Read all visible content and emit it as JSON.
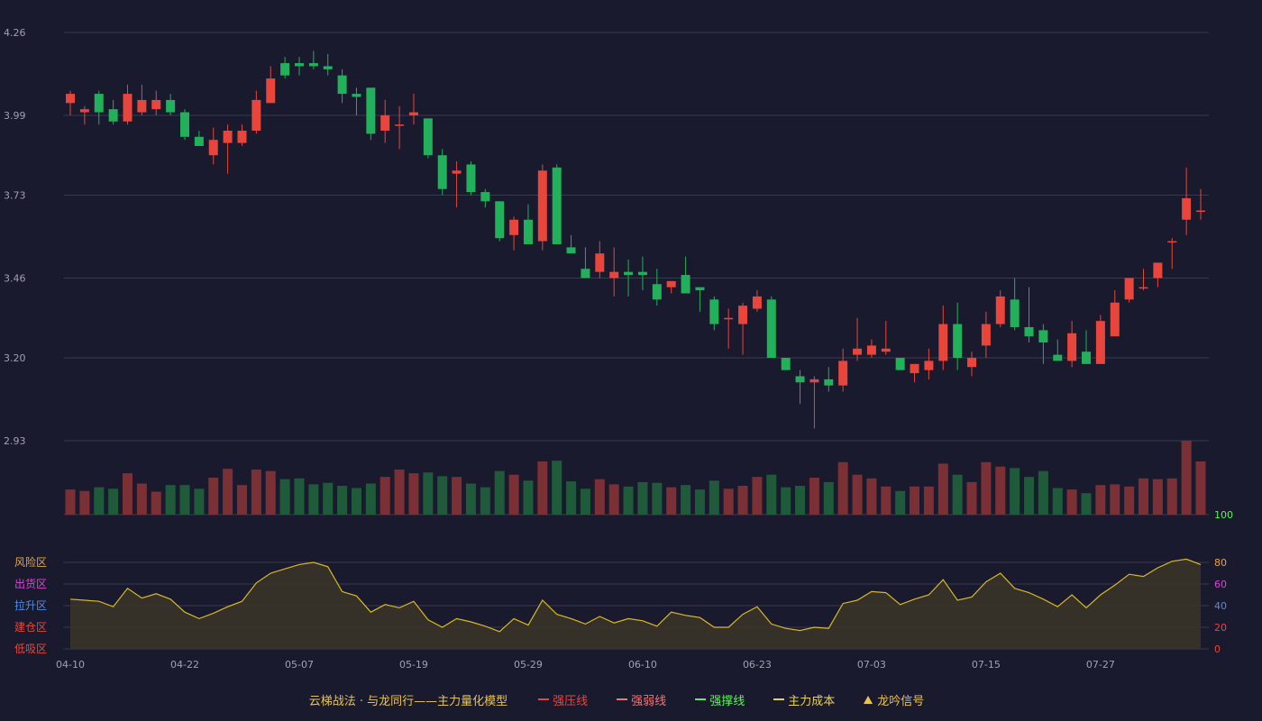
{
  "colors": {
    "background": "#1a1a2e",
    "up": "#e8453c",
    "down": "#22b05a",
    "vol_up": "#7a3035",
    "vol_down": "#1f5a3a",
    "grid": "#3a3a4e",
    "axis_text": "#a0a0b0",
    "osc_line": "#d9b823",
    "osc_fill": "#3a3428"
  },
  "chart_data": [
    {
      "type": "candlestick",
      "ylim": [
        2.93,
        4.26
      ],
      "yticks": [
        "4.26",
        "3.99",
        "3.73",
        "3.46",
        "3.20",
        "2.93"
      ],
      "x_tick_labels": [
        {
          "index": 0,
          "label": "04-10"
        },
        {
          "index": 8,
          "label": "04-22"
        },
        {
          "index": 16,
          "label": "05-07"
        },
        {
          "index": 24,
          "label": "05-19"
        },
        {
          "index": 32,
          "label": "05-29"
        },
        {
          "index": 40,
          "label": "06-10"
        },
        {
          "index": 48,
          "label": "06-23"
        },
        {
          "index": 56,
          "label": "07-03"
        },
        {
          "index": 64,
          "label": "07-15"
        },
        {
          "index": 72,
          "label": "07-27"
        }
      ],
      "candles": [
        [
          4.03,
          4.07,
          3.99,
          4.06
        ],
        [
          4.0,
          4.02,
          3.96,
          4.01
        ],
        [
          4.06,
          4.07,
          3.96,
          4.0
        ],
        [
          4.01,
          4.04,
          3.96,
          3.97
        ],
        [
          3.97,
          4.09,
          3.96,
          4.06
        ],
        [
          4.0,
          4.09,
          3.99,
          4.04
        ],
        [
          4.01,
          4.07,
          3.99,
          4.04
        ],
        [
          4.04,
          4.06,
          3.99,
          4.0
        ],
        [
          4.0,
          4.01,
          3.91,
          3.92
        ],
        [
          3.92,
          3.94,
          3.89,
          3.89
        ],
        [
          3.86,
          3.95,
          3.83,
          3.91
        ],
        [
          3.9,
          3.96,
          3.8,
          3.94
        ],
        [
          3.9,
          3.96,
          3.89,
          3.94
        ],
        [
          3.94,
          4.07,
          3.93,
          4.04
        ],
        [
          4.03,
          4.15,
          4.03,
          4.11
        ],
        [
          4.16,
          4.18,
          4.11,
          4.12
        ],
        [
          4.16,
          4.18,
          4.12,
          4.15
        ],
        [
          4.16,
          4.2,
          4.14,
          4.15
        ],
        [
          4.15,
          4.19,
          4.12,
          4.14
        ],
        [
          4.12,
          4.14,
          4.03,
          4.06
        ],
        [
          4.06,
          4.08,
          3.99,
          4.05
        ],
        [
          4.08,
          4.08,
          3.91,
          3.93
        ],
        [
          3.94,
          4.04,
          3.9,
          3.99
        ],
        [
          3.96,
          4.02,
          3.88,
          3.96
        ],
        [
          3.99,
          4.06,
          3.96,
          4.0
        ],
        [
          3.98,
          3.98,
          3.85,
          3.86
        ],
        [
          3.86,
          3.88,
          3.73,
          3.75
        ],
        [
          3.8,
          3.84,
          3.69,
          3.81
        ],
        [
          3.83,
          3.84,
          3.73,
          3.74
        ],
        [
          3.74,
          3.75,
          3.69,
          3.71
        ],
        [
          3.71,
          3.71,
          3.58,
          3.59
        ],
        [
          3.6,
          3.66,
          3.55,
          3.65
        ],
        [
          3.65,
          3.7,
          3.57,
          3.57
        ],
        [
          3.58,
          3.83,
          3.55,
          3.81
        ],
        [
          3.82,
          3.83,
          3.58,
          3.57
        ],
        [
          3.56,
          3.6,
          3.54,
          3.54
        ],
        [
          3.49,
          3.56,
          3.46,
          3.46
        ],
        [
          3.48,
          3.58,
          3.46,
          3.54
        ],
        [
          3.46,
          3.56,
          3.4,
          3.48
        ],
        [
          3.48,
          3.52,
          3.4,
          3.47
        ],
        [
          3.48,
          3.53,
          3.42,
          3.47
        ],
        [
          3.44,
          3.49,
          3.37,
          3.39
        ],
        [
          3.43,
          3.45,
          3.41,
          3.45
        ],
        [
          3.47,
          3.53,
          3.41,
          3.41
        ],
        [
          3.43,
          3.43,
          3.35,
          3.42
        ],
        [
          3.39,
          3.4,
          3.29,
          3.31
        ],
        [
          3.33,
          3.36,
          3.23,
          3.33
        ],
        [
          3.31,
          3.38,
          3.21,
          3.37
        ],
        [
          3.36,
          3.42,
          3.35,
          3.4
        ],
        [
          3.39,
          3.4,
          3.2,
          3.2
        ],
        [
          3.2,
          3.2,
          3.16,
          3.16
        ],
        [
          3.14,
          3.16,
          3.05,
          3.12
        ],
        [
          3.12,
          3.14,
          2.97,
          3.13
        ],
        [
          3.13,
          3.17,
          3.09,
          3.11
        ],
        [
          3.11,
          3.23,
          3.09,
          3.19
        ],
        [
          3.21,
          3.33,
          3.19,
          3.23
        ],
        [
          3.21,
          3.26,
          3.2,
          3.24
        ],
        [
          3.22,
          3.32,
          3.21,
          3.23
        ],
        [
          3.2,
          3.2,
          3.16,
          3.16
        ],
        [
          3.15,
          3.18,
          3.12,
          3.18
        ],
        [
          3.16,
          3.23,
          3.13,
          3.19
        ],
        [
          3.19,
          3.37,
          3.16,
          3.31
        ],
        [
          3.31,
          3.38,
          3.16,
          3.2
        ],
        [
          3.17,
          3.22,
          3.14,
          3.2
        ],
        [
          3.24,
          3.35,
          3.2,
          3.31
        ],
        [
          3.31,
          3.42,
          3.3,
          3.4
        ],
        [
          3.39,
          3.46,
          3.29,
          3.3
        ],
        [
          3.3,
          3.43,
          3.25,
          3.27
        ],
        [
          3.29,
          3.31,
          3.18,
          3.25
        ],
        [
          3.21,
          3.26,
          3.19,
          3.19
        ],
        [
          3.19,
          3.32,
          3.17,
          3.28
        ],
        [
          3.22,
          3.29,
          3.18,
          3.18
        ],
        [
          3.18,
          3.34,
          3.18,
          3.32
        ],
        [
          3.27,
          3.42,
          3.27,
          3.38
        ],
        [
          3.39,
          3.46,
          3.38,
          3.46
        ],
        [
          3.43,
          3.49,
          3.42,
          3.43
        ],
        [
          3.46,
          3.5,
          3.43,
          3.51
        ],
        [
          3.58,
          3.59,
          3.49,
          3.58
        ],
        [
          3.65,
          3.82,
          3.6,
          3.72
        ],
        [
          3.68,
          3.75,
          3.65,
          3.68
        ]
      ]
    },
    {
      "type": "bar",
      "name_visible": false,
      "volumes": [
        0.34,
        0.32,
        0.37,
        0.35,
        0.56,
        0.42,
        0.31,
        0.4,
        0.4,
        0.35,
        0.5,
        0.62,
        0.4,
        0.61,
        0.59,
        0.48,
        0.49,
        0.41,
        0.43,
        0.39,
        0.36,
        0.42,
        0.51,
        0.61,
        0.56,
        0.57,
        0.52,
        0.51,
        0.42,
        0.37,
        0.59,
        0.54,
        0.46,
        0.72,
        0.73,
        0.45,
        0.35,
        0.48,
        0.41,
        0.38,
        0.44,
        0.43,
        0.37,
        0.4,
        0.34,
        0.46,
        0.35,
        0.39,
        0.51,
        0.54,
        0.37,
        0.39,
        0.5,
        0.44,
        0.71,
        0.54,
        0.49,
        0.38,
        0.32,
        0.38,
        0.38,
        0.69,
        0.54,
        0.44,
        0.71,
        0.65,
        0.63,
        0.51,
        0.59,
        0.36,
        0.34,
        0.29,
        0.4,
        0.41,
        0.38,
        0.49,
        0.48,
        0.49,
        1.0,
        0.72
      ]
    },
    {
      "type": "area",
      "ylim": [
        0,
        100
      ],
      "yticks_right": [
        "100",
        "80",
        "60",
        "40",
        "20",
        "0"
      ],
      "zone_labels": [
        {
          "label": "风险区",
          "level": 80,
          "color": "#e8a33a"
        },
        {
          "label": "出货区",
          "level": 60,
          "color": "#e040d8"
        },
        {
          "label": "拉升区",
          "level": 40,
          "color": "#4a8ee8"
        },
        {
          "label": "建仓区",
          "level": 20,
          "color": "#e8453c"
        },
        {
          "label": "低吸区",
          "level": 0,
          "color": "#e8453c"
        }
      ],
      "values": [
        46,
        45,
        44,
        39,
        56,
        47,
        51,
        46,
        34,
        28,
        33,
        39,
        44,
        61,
        70,
        74,
        78,
        80,
        76,
        53,
        49,
        34,
        41,
        38,
        44,
        27,
        20,
        28,
        25,
        21,
        16,
        28,
        22,
        45,
        32,
        28,
        23,
        30,
        24,
        28,
        26,
        21,
        34,
        31,
        29,
        20,
        20,
        32,
        39,
        23,
        19,
        17,
        20,
        19,
        42,
        45,
        53,
        52,
        41,
        46,
        50,
        64,
        45,
        48,
        62,
        70,
        56,
        52,
        46,
        39,
        50,
        38,
        50,
        59,
        69,
        67,
        75,
        81,
        83,
        78
      ]
    }
  ],
  "legend": {
    "title": "云梯战法 · 与龙同行——主力量化模型",
    "items": [
      {
        "label": "强压线",
        "color": "#e8453c",
        "style": "solid"
      },
      {
        "label": "强弱线",
        "color": "#e87a7a",
        "style": "dashed"
      },
      {
        "label": "强撑线",
        "color": "#5ef05e",
        "style": "solid"
      },
      {
        "label": "主力成本",
        "color": "#e8d44a",
        "style": "dashed"
      },
      {
        "label": "龙吟信号",
        "color": "#e8c44a",
        "style": "triangle"
      }
    ]
  }
}
